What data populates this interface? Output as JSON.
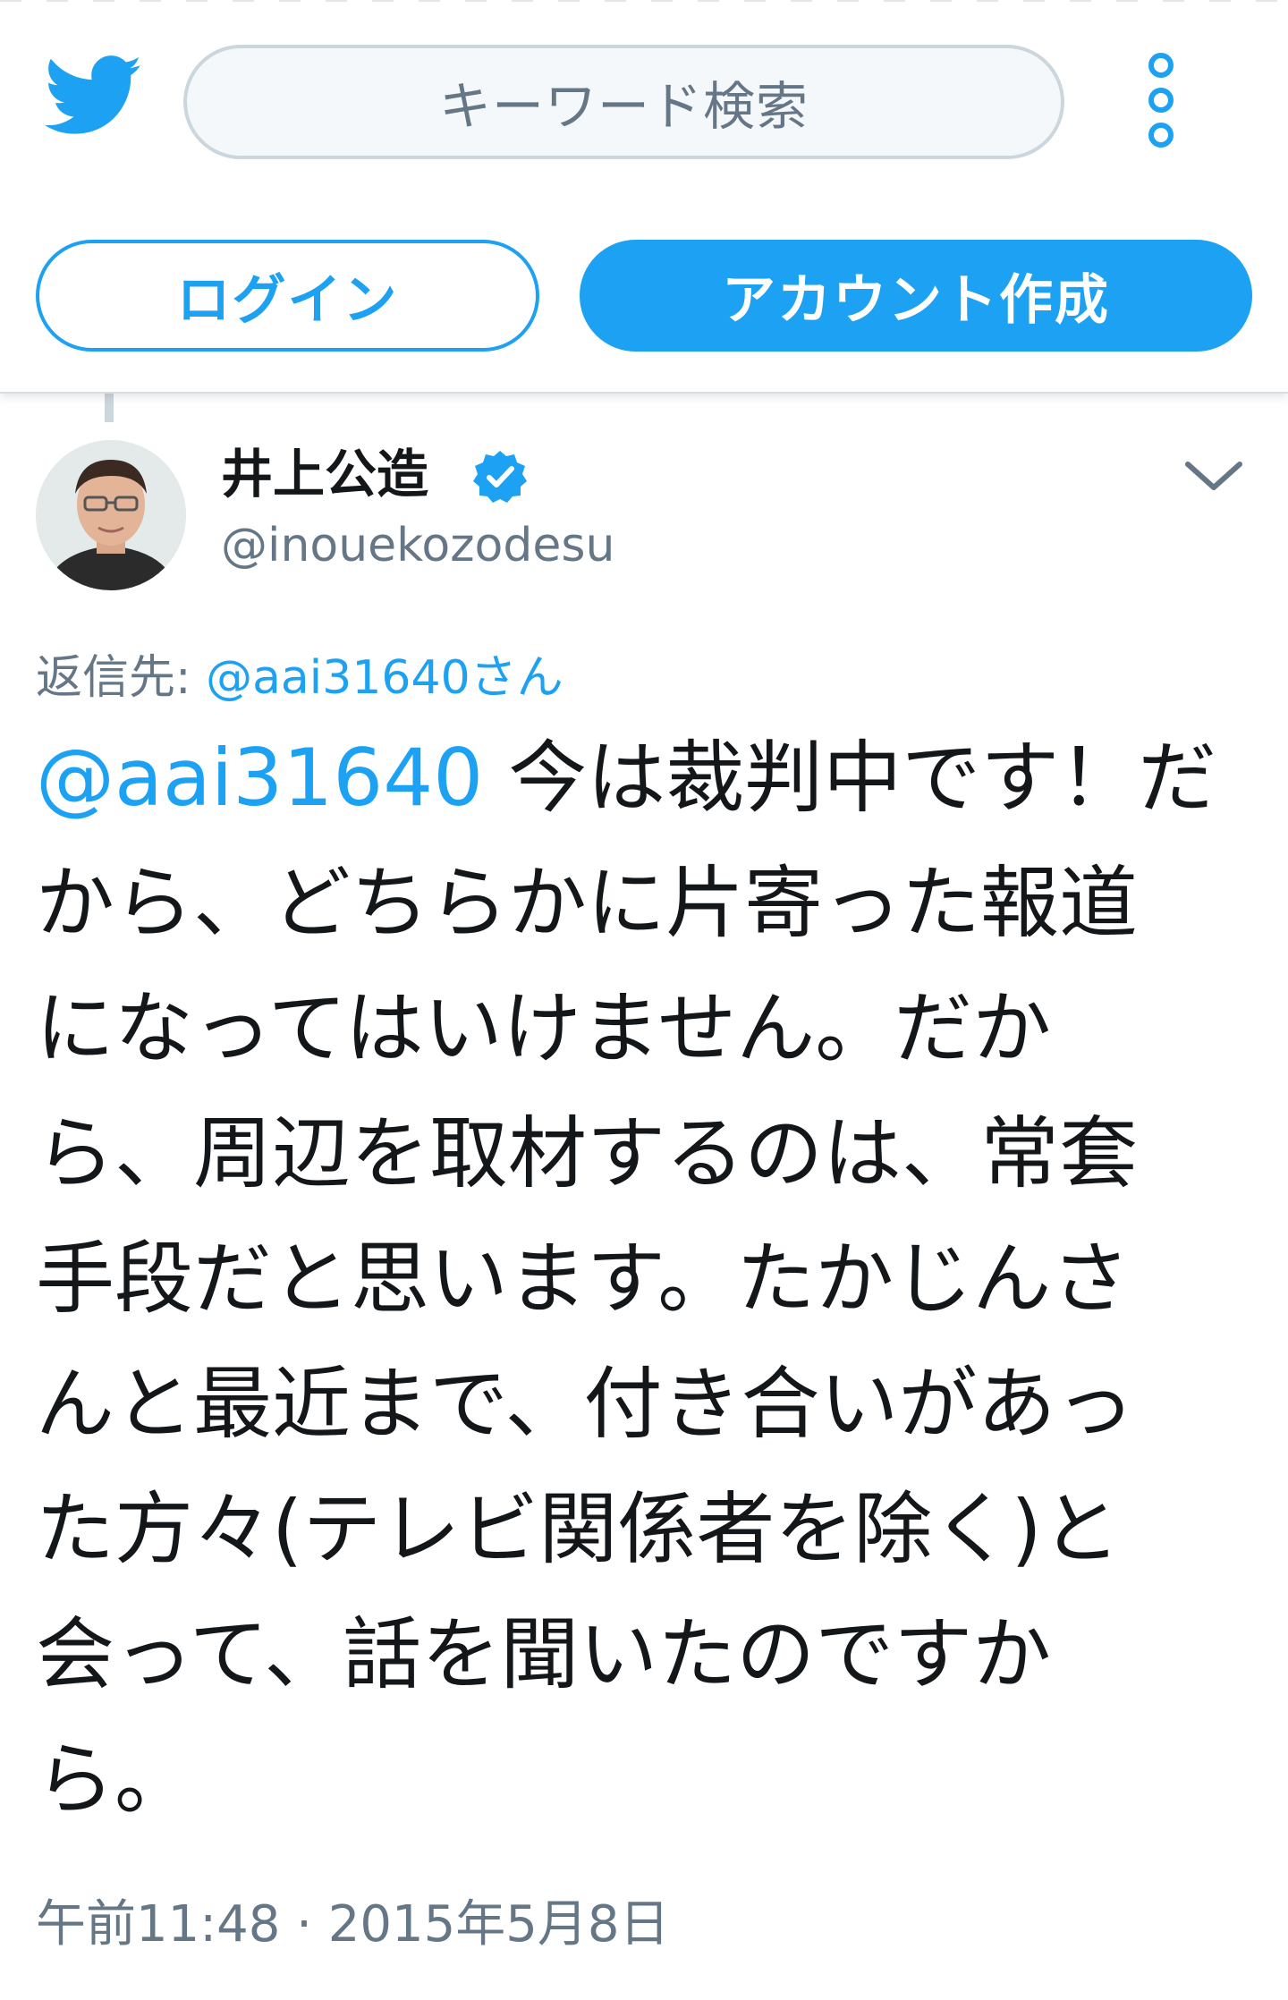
{
  "header": {
    "search_placeholder": "キーワード検索",
    "login_label": "ログイン",
    "signup_label": "アカウント作成"
  },
  "tweet": {
    "display_name": "井上公造",
    "handle": "@inouekozodesu",
    "reply_prefix": "返信先: ",
    "reply_to": "@aai31640さん",
    "mention": "@aai31640",
    "lines": [
      " 今は裁判中です！だ",
      "から、どちらかに片寄った報道",
      "になってはいけません。だか",
      "ら、周辺を取材するのは、常套",
      "手段だと思います。たかじんさ",
      "んと最近まで、付き合いがあっ",
      "た方々(テレビ関係者を除く)と",
      "会って、話を聞いたのですか",
      "ら。"
    ],
    "timestamp": "午前11:48 · 2015年5月8日"
  },
  "colors": {
    "brand_blue": "#1da1f2",
    "secondary_text": "#657786",
    "primary_text": "#14171a"
  },
  "icons": {
    "logo": "twitter-bird-icon",
    "menu": "more-vertical-icon",
    "verified": "verified-badge-icon",
    "caret": "chevron-down-icon"
  }
}
